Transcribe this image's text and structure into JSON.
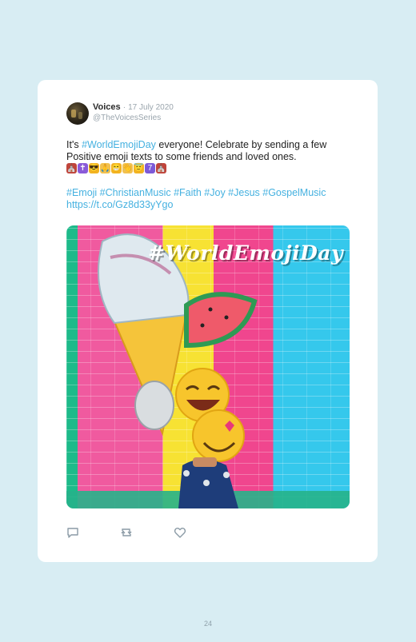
{
  "tweet": {
    "display_name": "Voices",
    "separator": "·",
    "date": "17 July 2020",
    "handle": "@TheVoicesSeries",
    "text_prefix": "It's ",
    "text_hashtag": "#WorldEmojiDay",
    "text_rest": " everyone! Celebrate by sending a few Positive emoji texts to some friends and loved ones.",
    "hashtags": "#Emoji #ChristianMusic #Faith #Joy #Jesus #GospelMusic",
    "link": "https://t.co/Gz8d33yYgo",
    "image_caption": "#WorldEmojiDay"
  },
  "emojis": [
    {
      "icon": "church-icon",
      "glyph": "⛪",
      "color": "#c0443b"
    },
    {
      "icon": "cross-icon",
      "glyph": "✝",
      "color": "#8a5bd8"
    },
    {
      "icon": "sunglasses-face-icon",
      "glyph": "😎",
      "color": "#f2b422"
    },
    {
      "icon": "praying-hands-icon",
      "glyph": "🙏",
      "color": "#f2c14e"
    },
    {
      "icon": "grinning-face-icon",
      "glyph": "😁",
      "color": "#f2b422"
    },
    {
      "icon": "hand-wave-icon",
      "glyph": "👋",
      "color": "#f2c14e"
    },
    {
      "icon": "smiling-face-icon",
      "glyph": "😇",
      "color": "#f2b422"
    },
    {
      "icon": "number-seven-icon",
      "glyph": "7",
      "color": "#7d5ad8"
    },
    {
      "icon": "church-icon",
      "glyph": "⛪",
      "color": "#c0443b"
    }
  ],
  "page_number": "24"
}
